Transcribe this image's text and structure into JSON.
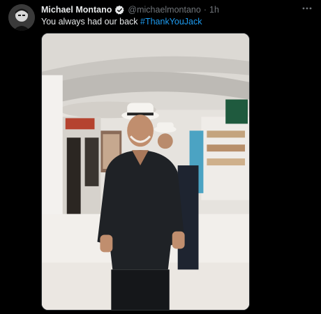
{
  "tweet": {
    "author_name": "Michael Montano",
    "author_handle": "@michaelmontano",
    "separator": "·",
    "time": "1h",
    "text_plain": "You always had our back ",
    "hashtag": "#ThankYouJack",
    "more_icon": "more-horizontal-icon",
    "verified_icon": "verified-badge-icon"
  },
  "colors": {
    "background": "#000000",
    "text_primary": "#e7e9ea",
    "text_secondary": "#71767b",
    "link": "#1d9bf0"
  }
}
